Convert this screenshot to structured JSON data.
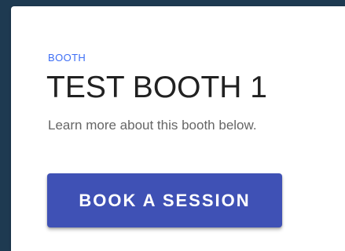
{
  "booth": {
    "eyebrow": "BOOTH",
    "title": "TEST BOOTH 1",
    "subtitle": "Learn more about this booth below.",
    "book_button_label": "BOOK A SESSION"
  },
  "colors": {
    "accent": "#3f51b5",
    "eyebrow": "#3d6ef5",
    "background": "#1e3a51"
  }
}
